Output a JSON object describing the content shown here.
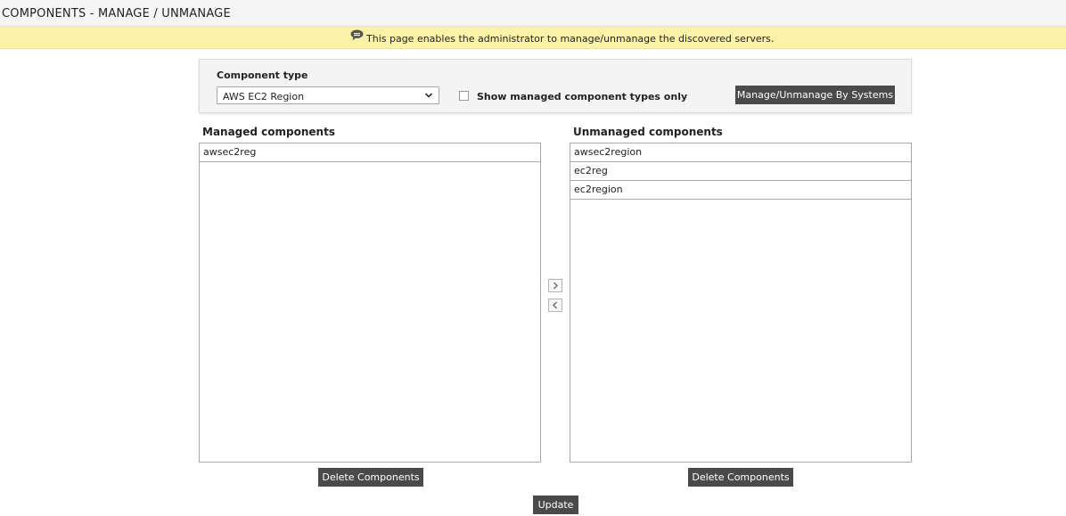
{
  "header": {
    "title": "COMPONENTS - MANAGE / UNMANAGE"
  },
  "info": {
    "icon": "speech-bubble-icon",
    "text": "This page enables the administrator to manage/unmanage the discovered servers."
  },
  "component_type": {
    "label": "Component type",
    "selected": "AWS EC2 Region",
    "show_managed_only_label": "Show managed component types only",
    "show_managed_only_checked": false,
    "manage_by_systems_label": "Manage/Unmanage By Systems"
  },
  "managed": {
    "title": "Managed components",
    "items": [
      "awsec2reg"
    ],
    "delete_label": "Delete Components"
  },
  "unmanaged": {
    "title": "Unmanaged components",
    "items": [
      "awsec2region",
      "ec2reg",
      "ec2region"
    ],
    "delete_label": "Delete Components"
  },
  "update_label": "Update",
  "colors": {
    "info_bar": "#fdf3a8",
    "button_dark": "#4a4a4a"
  }
}
